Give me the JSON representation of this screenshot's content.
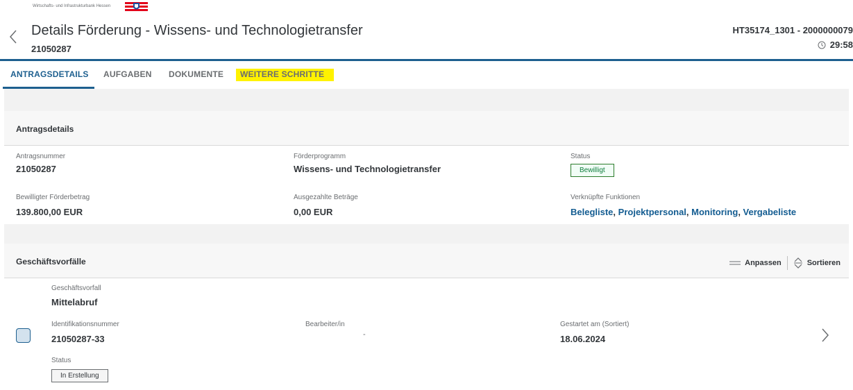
{
  "header": {
    "bank_name": "Wirtschafts- und Infrastrukturbank Hessen",
    "title": "Details Förderung - Wissens- und Technologietransfer",
    "subtitle_id": "21050287",
    "reference": "HT35174_1301 - 2000000079",
    "timer": "29:58",
    "icons": [
      "chevron-left-icon",
      "clock-icon"
    ]
  },
  "tabs": [
    {
      "label": "ANTRAGSDETAILS",
      "active": true
    },
    {
      "label": "AUFGABEN",
      "active": false
    },
    {
      "label": "DOKUMENTE",
      "active": false
    },
    {
      "label": "WEITERE SCHRITTE",
      "active": false,
      "highlighted": true
    }
  ],
  "antragsdetails": {
    "section_title": "Antragsdetails",
    "fields": {
      "antragsnummer_label": "Antragsnummer",
      "antragsnummer_value": "21050287",
      "foerderprogramm_label": "Förderprogramm",
      "foerderprogramm_value": "Wissens- und Technologietransfer",
      "status_label": "Status",
      "status_value": "Bewilligt",
      "bewilligt_label": "Bewilligter Förderbetrag",
      "bewilligt_value": "139.800,00 EUR",
      "ausgezahlt_label": "Ausgezahlte Beträge",
      "ausgezahlt_value": "0,00 EUR",
      "funktionen_label": "Verknüpfte Funktionen",
      "funktionen": [
        "Belegliste",
        "Projektpersonal",
        "Monitoring",
        "Vergabeliste"
      ],
      "separator": ", "
    }
  },
  "geschaeftsvorfaelle": {
    "section_title": "Geschäftsvorfälle",
    "anpassen": "Anpassen",
    "sortieren": "Sortieren",
    "item": {
      "vorfall_label": "Geschäftsvorfall",
      "vorfall_value": "Mittelabruf",
      "id_label": "Identifikationsnummer",
      "id_value": "21050287-33",
      "bearbeiter_label": "Bearbeiter/in",
      "bearbeiter_value": "-",
      "gestartet_label": "Gestartet am (Sortiert)",
      "gestartet_value": "18.06.2024",
      "status_label": "Status",
      "status_value": "In Erstellung"
    }
  },
  "colors": {
    "accent": "#1d5f8f",
    "link": "#135c91",
    "highlight": "#fff200",
    "success": "#107e3e"
  }
}
